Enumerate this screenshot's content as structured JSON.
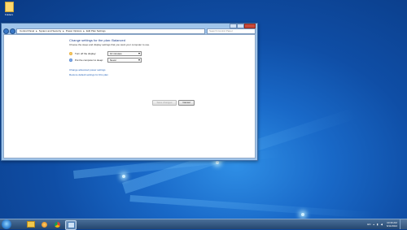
{
  "desktop": {
    "icon_label": "Folders"
  },
  "window": {
    "breadcrumb": [
      "Control Panel",
      "System and Security",
      "Power Options",
      "Edit Plan Settings"
    ],
    "search_placeholder": "Search Control Panel",
    "heading": "Change settings for the plan: Balanced",
    "description": "Choose the sleep and display settings that you want your computer to use.",
    "settings": [
      {
        "label": "Turn off the display:",
        "value": "10 minutes",
        "icon": "monitor-icon"
      },
      {
        "label": "Put the computer to sleep:",
        "value": "Never",
        "icon": "moon-icon"
      }
    ],
    "links": {
      "advanced": "Change advanced power settings",
      "restore": "Restore default settings for this plan"
    },
    "buttons": {
      "save": "Save changes",
      "cancel": "Cancel"
    }
  },
  "taskbar": {
    "apps": [
      "explorer-icon",
      "media-player-icon",
      "chrome-icon",
      "control-panel-icon"
    ],
    "tray": {
      "lang": "EN",
      "time": "10:39 AM",
      "date": "6/11/2024"
    }
  },
  "colors": {
    "desktop_blue": "#1969c8",
    "link_blue": "#1f5fb8",
    "heading_blue": "#1e3f8a"
  }
}
